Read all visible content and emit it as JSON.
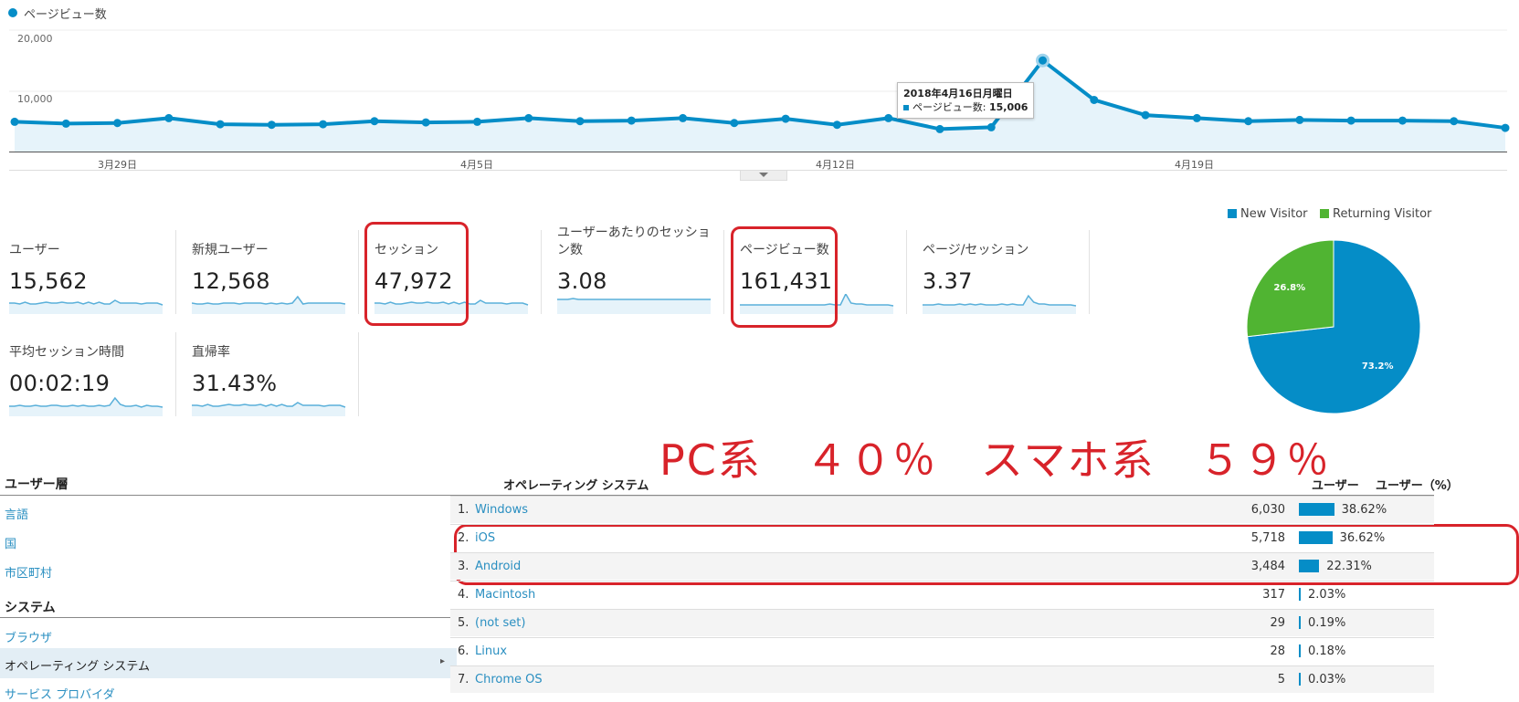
{
  "line_chart": {
    "legend_label": "ページビュー数",
    "y_ticks": [
      "20,000",
      "10,000"
    ],
    "x_ticks": [
      "3月29日",
      "4月5日",
      "4月12日",
      "4月19日"
    ],
    "series_color": "#058dc7",
    "tooltip": {
      "date": "2018年4月16日月曜日",
      "label": "ページビュー数: ",
      "value": "15,006"
    }
  },
  "chart_data": [
    {
      "type": "line",
      "series": [
        {
          "name": "ページビュー数",
          "values": [
            4900,
            4600,
            4700,
            5500,
            4500,
            4400,
            4500,
            5000,
            4800,
            4900,
            5500,
            5000,
            5100,
            5500,
            4700,
            5400,
            4400,
            5500,
            3700,
            4000,
            15006,
            8500,
            6000,
            5500,
            5000,
            5200,
            5100,
            5100,
            5000,
            3900
          ]
        }
      ],
      "x_ticks": [
        "3月29日",
        "4月5日",
        "4月12日",
        "4月19日"
      ],
      "ylim": [
        0,
        20000
      ]
    },
    {
      "type": "pie",
      "categories": [
        "New Visitor",
        "Returning Visitor"
      ],
      "values": [
        73.2,
        26.8
      ],
      "labels": [
        "73.2%",
        "26.8%"
      ],
      "colors": [
        "#058dc7",
        "#50b432"
      ]
    }
  ],
  "metrics": [
    {
      "label": "ユーザー",
      "value": "15,562"
    },
    {
      "label": "新規ユーザー",
      "value": "12,568"
    },
    {
      "label": "セッション",
      "value": "47,972"
    },
    {
      "label": "ユーザーあたりのセッション数",
      "value": "3.08"
    },
    {
      "label": "ページビュー数",
      "value": "161,431"
    },
    {
      "label": "ページ/セッション",
      "value": "3.37"
    },
    {
      "label": "平均セッション時間",
      "value": "00:02:19"
    },
    {
      "label": "直帰率",
      "value": "31.43%"
    }
  ],
  "pie_legend": [
    "New Visitor",
    "Returning Visitor"
  ],
  "annotation": "PC系　４０％　スマホ系　５９％",
  "left_nav": {
    "section1": "ユーザー層",
    "links1": [
      "言語",
      "国",
      "市区町村"
    ],
    "section2": "システム",
    "links2": [
      "ブラウザ"
    ],
    "selected": "オペレーティング システム",
    "links3": [
      "サービス プロバイダ"
    ]
  },
  "table": {
    "headers": {
      "os": "オペレーティング システム",
      "users": "ユーザー",
      "pct": "ユーザー（%）"
    },
    "rows": [
      {
        "num": "1.",
        "os": "Windows",
        "users": "6,030",
        "pct": "38.62%",
        "share": 38.62
      },
      {
        "num": "2.",
        "os": "iOS",
        "users": "5,718",
        "pct": "36.62%",
        "share": 36.62
      },
      {
        "num": "3.",
        "os": "Android",
        "users": "3,484",
        "pct": "22.31%",
        "share": 22.31
      },
      {
        "num": "4.",
        "os": "Macintosh",
        "users": "317",
        "pct": "2.03%",
        "share": 2.03
      },
      {
        "num": "5.",
        "os": "(not set)",
        "users": "29",
        "pct": "0.19%",
        "share": 0.19
      },
      {
        "num": "6.",
        "os": "Linux",
        "users": "28",
        "pct": "0.18%",
        "share": 0.18
      },
      {
        "num": "7.",
        "os": "Chrome OS",
        "users": "5",
        "pct": "0.03%",
        "share": 0.03
      }
    ]
  }
}
